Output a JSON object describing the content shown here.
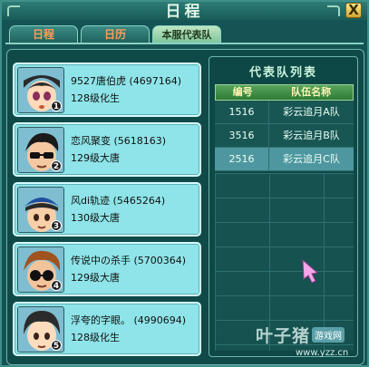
{
  "window": {
    "title": "日程",
    "close_label": "X"
  },
  "tabs": [
    {
      "label": "日程"
    },
    {
      "label": "日历"
    },
    {
      "label": "本服代表队"
    }
  ],
  "characters": [
    {
      "name": "9527唐伯虎 (4697164)",
      "level": "128级化生",
      "rank": "1"
    },
    {
      "name": "恋风聚变 (5618163)",
      "level": "129级大唐",
      "rank": "2"
    },
    {
      "name": "风di轨迹 (5465264)",
      "level": "130级大唐",
      "rank": "3"
    },
    {
      "name": "传说中の杀手 (5700364)",
      "level": "129级大唐",
      "rank": "4"
    },
    {
      "name": "浮夸的字眼。 (4990694)",
      "level": "128级化生",
      "rank": "5"
    }
  ],
  "team_list": {
    "title": "代表队列表",
    "headers": {
      "id": "编号",
      "name": "队伍名称"
    },
    "rows": [
      {
        "id": "1516",
        "name": "彩云追月A队"
      },
      {
        "id": "3516",
        "name": "彩云追月B队"
      },
      {
        "id": "2516",
        "name": "彩云追月C队"
      }
    ]
  },
  "watermark": {
    "brand": "叶子猪",
    "tag": "游戏网",
    "url": "www.yzz.cn"
  }
}
